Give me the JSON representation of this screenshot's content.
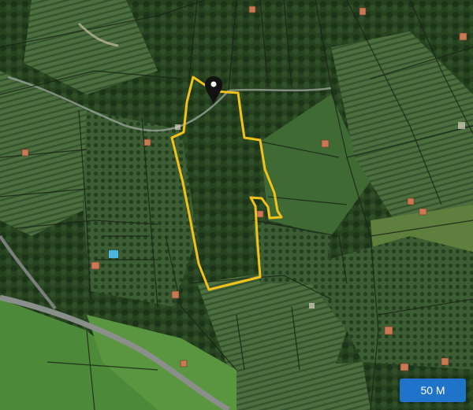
{
  "map": {
    "type": "satellite",
    "colors": {
      "parcel_outline": "#f2c21b",
      "cadastral_lines": "#1b2418",
      "road": "#8a8f8c",
      "marker": "#111111",
      "scale_button_bg": "#1f73c9"
    },
    "icons": [
      "location-pin-icon"
    ]
  },
  "scale": {
    "label": "50 M"
  }
}
